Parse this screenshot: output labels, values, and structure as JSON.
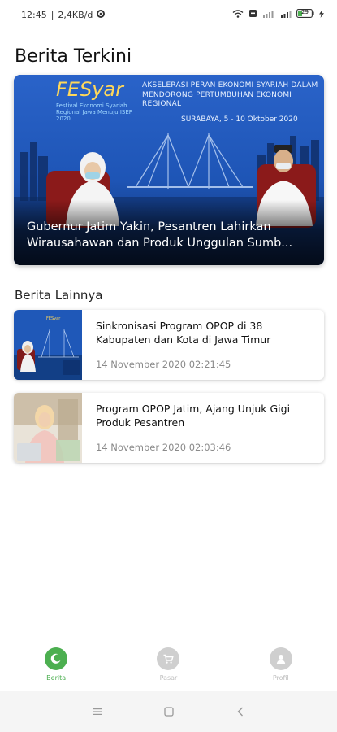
{
  "status_bar": {
    "time": "12:45",
    "net_speed": "2,4KB/d",
    "battery_level": "29",
    "icons": [
      "settings-icon",
      "wifi-icon",
      "data-saver-icon",
      "signal-icon",
      "signal-icon",
      "battery-icon",
      "charging-icon"
    ]
  },
  "page": {
    "title": "Berita Terkini"
  },
  "featured": {
    "brand": "FESyar",
    "brand_sub": "Festival Ekonomi Syariah Regional Jawa Menuju ISEF 2020",
    "banner_text": "AKSELERASI PERAN EKONOMI SYARIAH DALAM MENDORONG PERTUMBUHAN EKONOMI REGIONAL",
    "location": "SURABAYA, 5 - 10 Oktober 2020",
    "title": "Gubernur Jatim Yakin, Pesantren Lahirkan Wirausahawan dan Produk Unggulan  Sumb...",
    "accent_color": "#1e5bbd"
  },
  "other_news": {
    "section_title": "Berita Lainnya",
    "items": [
      {
        "title": "Sinkronisasi Program OPOP di 38 Kabupaten dan Kota di Jawa Timur",
        "date": "14 November 2020 02:21:45"
      },
      {
        "title": "Program OPOP Jatim, Ajang Unjuk Gigi Produk Pesantren",
        "date": "14 November 2020 02:03:46"
      }
    ]
  },
  "bottom_nav": {
    "items": [
      {
        "label": "Berita",
        "icon": "news-icon",
        "active": true
      },
      {
        "label": "Pasar",
        "icon": "cart-icon",
        "active": false
      },
      {
        "label": "Profil",
        "icon": "profile-icon",
        "active": false
      }
    ],
    "active_color": "#4caf50",
    "inactive_color": "#bdbdbd"
  },
  "system_nav": {
    "icons": [
      "menu-icon",
      "home-icon",
      "back-icon"
    ]
  }
}
